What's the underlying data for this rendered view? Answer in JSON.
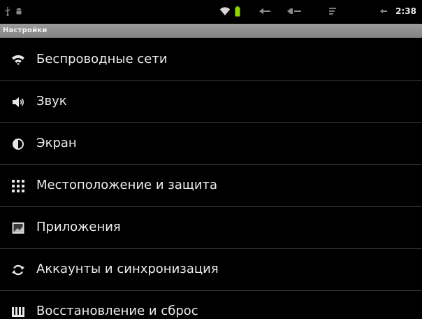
{
  "status_bar": {
    "time": "2:38",
    "icons": [
      "usb-icon",
      "android-icon",
      "wifi-icon",
      "battery-icon",
      "back-icon",
      "volume-down-icon",
      "menu-icon",
      "volume-up-icon"
    ]
  },
  "header": {
    "title": "Настройки"
  },
  "settings": {
    "items": [
      {
        "label": "Беспроводные сети",
        "icon": "wifi-icon"
      },
      {
        "label": "Звук",
        "icon": "speaker-icon"
      },
      {
        "label": "Экран",
        "icon": "brightness-icon"
      },
      {
        "label": "Местоположение и защита",
        "icon": "location-grid-icon"
      },
      {
        "label": "Приложения",
        "icon": "applications-icon"
      },
      {
        "label": "Аккаунты и синхронизация",
        "icon": "sync-icon"
      },
      {
        "label": "Восстановление и сброс",
        "icon": "reset-icon"
      }
    ]
  },
  "colors": {
    "background": "#000000",
    "title_bar": "#8f8f8f",
    "text": "#ececec",
    "divider": "#3a3a3a",
    "battery": "#8fd800"
  }
}
